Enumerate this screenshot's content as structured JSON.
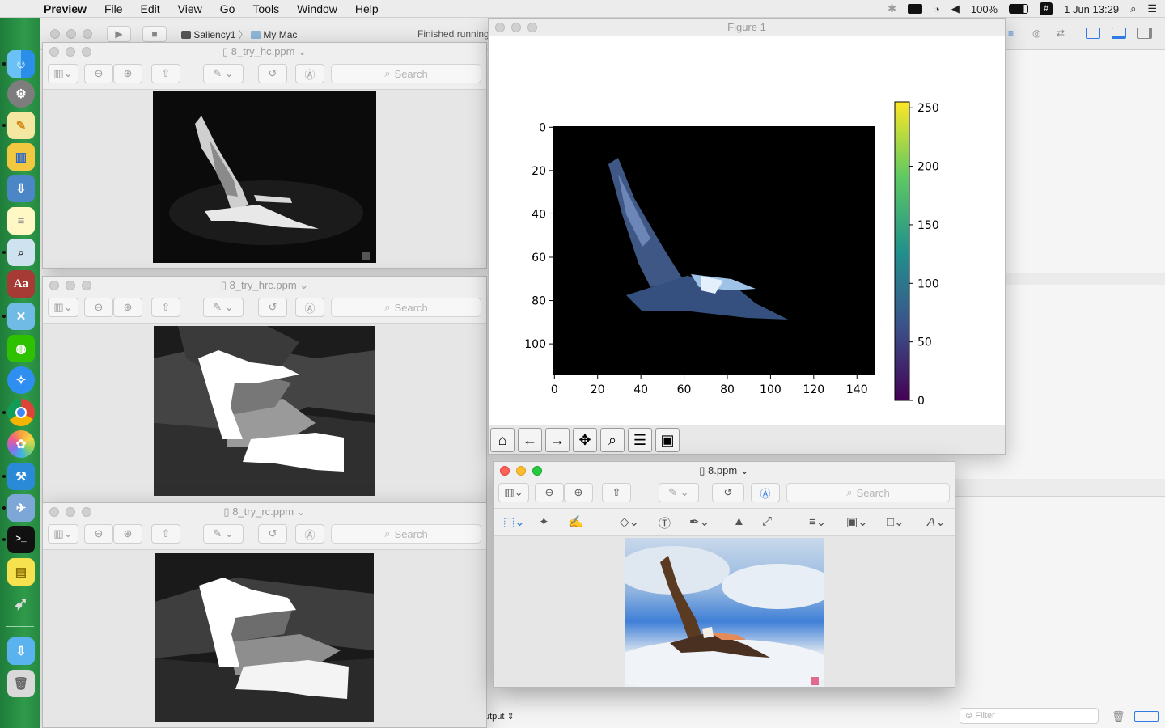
{
  "menubar": {
    "app": "Preview",
    "items": [
      "File",
      "Edit",
      "View",
      "Go",
      "Tools",
      "Window",
      "Help"
    ],
    "battery": "100%",
    "datetime": "1 Jun  13:29"
  },
  "xcode": {
    "scheme": "Saliency1",
    "destination": "My Mac",
    "status": "Finished running",
    "console_selector": "utput",
    "filter_placeholder": "Filter"
  },
  "preview_windows": [
    {
      "title": "8_try_hc.ppm",
      "search": "Search"
    },
    {
      "title": "8_try_hrc.ppm",
      "search": "Search"
    },
    {
      "title": "8_try_rc.ppm",
      "search": "Search"
    }
  ],
  "figure": {
    "title": "Figure 1",
    "x_ticks": [
      "0",
      "20",
      "40",
      "60",
      "80",
      "100",
      "120",
      "140"
    ],
    "y_ticks": [
      "0",
      "20",
      "40",
      "60",
      "80",
      "100"
    ],
    "colorbar_ticks": [
      "0",
      "50",
      "100",
      "150",
      "200",
      "250"
    ],
    "toolbar_icons": [
      "home-icon",
      "back-arrow-icon",
      "forward-arrow-icon",
      "pan-icon",
      "zoom-icon",
      "configure-icon",
      "save-icon"
    ]
  },
  "main_preview": {
    "title": "8.ppm",
    "search": "Search"
  }
}
